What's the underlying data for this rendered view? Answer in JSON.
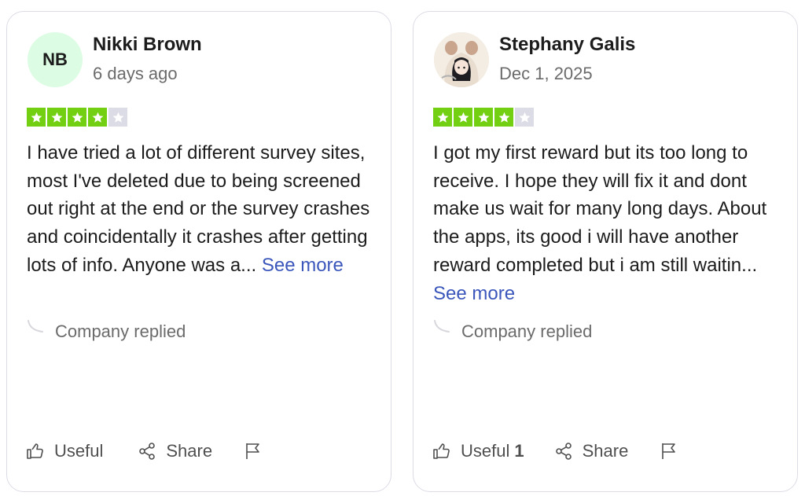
{
  "reviews": [
    {
      "avatar_initials": "NB",
      "name": "Nikki Brown",
      "date": "6 days ago",
      "rating": 4,
      "max_rating": 5,
      "text": "I have tried a lot of different survey sites, most I've deleted due to being screened out right at the end or the survey crashes and coincidentally it crashes after getting lots of info. Anyone was a... ",
      "see_more": "See more",
      "replied": "Company replied",
      "useful_label": "Useful",
      "useful_count": "",
      "share_label": "Share"
    },
    {
      "avatar_initials": "",
      "name": "Stephany Galis",
      "date": "Dec 1, 2025",
      "rating": 4,
      "max_rating": 5,
      "text": "I got my first reward but its too long to receive. I hope they will fix it and dont make us wait for many long days. About the apps, its good i will have another reward completed but i am still waitin... ",
      "see_more": "See more",
      "replied": "Company replied",
      "useful_label": "Useful",
      "useful_count": "1",
      "share_label": "Share"
    }
  ],
  "colors": {
    "star_filled": "#73cf11",
    "star_empty": "#dcdce6",
    "link": "#3c57bc",
    "initials_avatar_bg": "#dcfce3"
  },
  "icons": {
    "useful": "thumbs-up-icon",
    "share": "share-icon",
    "report": "flag-icon",
    "replied": "reply-corner-icon"
  }
}
